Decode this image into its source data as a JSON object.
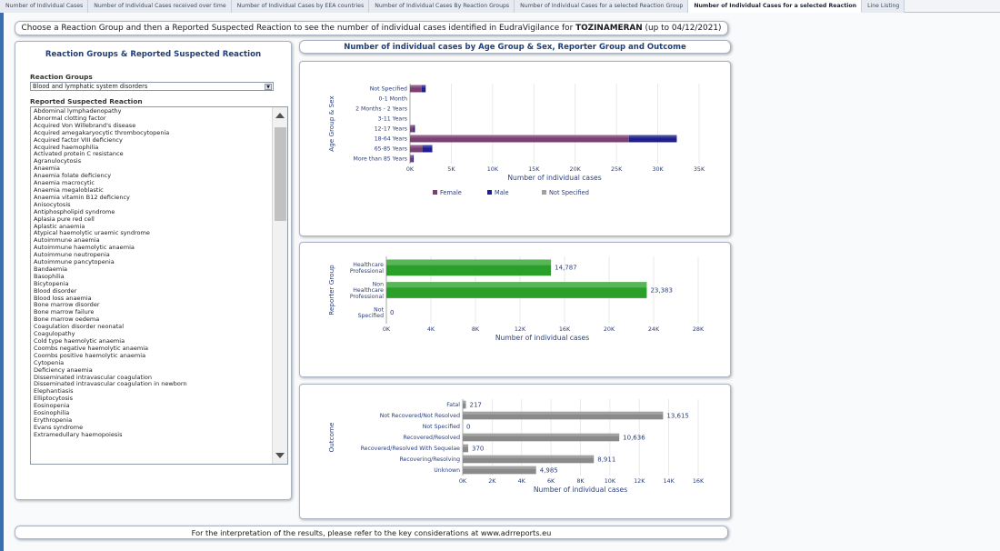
{
  "tabs": [
    {
      "label": "Number of Individual Cases",
      "active": false
    },
    {
      "label": "Number of Individual Cases received over time",
      "active": false
    },
    {
      "label": "Number of Individual Cases by EEA countries",
      "active": false
    },
    {
      "label": "Number of Individual Cases By Reaction Groups",
      "active": false
    },
    {
      "label": "Number of Individual Cases for a selected Reaction Group",
      "active": false
    },
    {
      "label": "Number of Individual Cases for a selected Reaction",
      "active": true
    },
    {
      "label": "Line Listing",
      "active": false
    }
  ],
  "header": {
    "text_before": "Choose a Reaction Group and then a Reported Suspected Reaction to see the number of individual cases identified in EudraVigilance for ",
    "product": "TOZINAMERAN",
    "text_after": " (up to 04/12/2021)"
  },
  "left_panel": {
    "title": "Reaction Groups & Reported Suspected Reaction",
    "reaction_groups_label": "Reaction Groups",
    "reaction_group_selected": "Blood and lymphatic system disorders",
    "reported_reaction_label": "Reported Suspected Reaction",
    "reactions": [
      "Abdominal lymphadenopathy",
      "Abnormal clotting factor",
      "Acquired Von Willebrand's disease",
      "Acquired amegakaryocytic thrombocytopenia",
      "Acquired factor VIII deficiency",
      "Acquired haemophilia",
      "Activated protein C resistance",
      "Agranulocytosis",
      "Anaemia",
      "Anaemia folate deficiency",
      "Anaemia macrocytic",
      "Anaemia megaloblastic",
      "Anaemia vitamin B12 deficiency",
      "Anisocytosis",
      "Antiphospholipid syndrome",
      "Aplasia pure red cell",
      "Aplastic anaemia",
      "Atypical haemolytic uraemic syndrome",
      "Autoimmune anaemia",
      "Autoimmune haemolytic anaemia",
      "Autoimmune neutropenia",
      "Autoimmune pancytopenia",
      "Bandaemia",
      "Basophilia",
      "Bicytopenia",
      "Blood disorder",
      "Blood loss anaemia",
      "Bone marrow disorder",
      "Bone marrow failure",
      "Bone marrow oedema",
      "Coagulation disorder neonatal",
      "Coagulopathy",
      "Cold type haemolytic anaemia",
      "Coombs negative haemolytic anaemia",
      "Coombs positive haemolytic anaemia",
      "Cytopenia",
      "Deficiency anaemia",
      "Disseminated intravascular coagulation",
      "Disseminated intravascular coagulation in newborn",
      "Elephantiasis",
      "Elliptocytosis",
      "Eosinopenia",
      "Eosinophilia",
      "Erythropenia",
      "Evans syndrome",
      "Extramedullary haemopoiesis"
    ]
  },
  "right_title": "Number of individual cases by Age Group & Sex, Reporter Group and Outcome",
  "footer": "For the interpretation of the results, please refer to the key considerations at www.adrreports.eu",
  "colors": {
    "female": "#7b3f73",
    "male": "#1f1f8f",
    "not_specified": "#a0a0a0",
    "reporter": "#2aa02a",
    "outcome": "#8a8a8a",
    "axis_text": "#2b3e78"
  },
  "chart_data": [
    {
      "type": "bar",
      "orientation": "horizontal",
      "stacked": true,
      "categories": [
        "Not Specified",
        "0-1 Month",
        "2 Months - 2 Years",
        "3-11 Years",
        "12-17 Years",
        "18-64 Years",
        "65-85 Years",
        "More than 85 Years"
      ],
      "series": [
        {
          "name": "Female",
          "values": [
            1400,
            0,
            0,
            0,
            400,
            26500,
            1500,
            300
          ]
        },
        {
          "name": "Male",
          "values": [
            500,
            0,
            0,
            0,
            200,
            5800,
            1200,
            150
          ]
        },
        {
          "name": "Not Specified",
          "values": [
            0,
            0,
            0,
            0,
            0,
            0,
            0,
            0
          ]
        }
      ],
      "xlabel": "Number of individual cases",
      "ylabel": "Age Group & Sex",
      "xlim": [
        0,
        35000
      ],
      "ticks": [
        "0K",
        "5K",
        "10K",
        "15K",
        "20K",
        "25K",
        "30K",
        "35K"
      ],
      "legend": "bottom",
      "grid": true
    },
    {
      "type": "bar",
      "orientation": "horizontal",
      "categories": [
        "Healthcare Professional",
        "Non Healthcare Professional",
        "Not Specified"
      ],
      "values": [
        14787,
        23383,
        0
      ],
      "labels": [
        "14,787",
        "23,383",
        "0"
      ],
      "xlabel": "Number of individual cases",
      "ylabel": "Reporter Group",
      "xlim": [
        0,
        28000
      ],
      "ticks": [
        "0K",
        "4K",
        "8K",
        "12K",
        "16K",
        "20K",
        "24K",
        "28K"
      ],
      "grid": true
    },
    {
      "type": "bar",
      "orientation": "horizontal",
      "categories": [
        "Fatal",
        "Not Recovered/Not Resolved",
        "Not Specified",
        "Recovered/Resolved",
        "Recovered/Resolved With Sequelae",
        "Recovering/Resolving",
        "Unknown"
      ],
      "values": [
        217,
        13615,
        0,
        10636,
        370,
        8911,
        4985
      ],
      "labels": [
        "217",
        "13,615",
        "0",
        "10,636",
        "370",
        "8,911",
        "4,985"
      ],
      "xlabel": "Number of individual cases",
      "ylabel": "Outcome",
      "xlim": [
        0,
        16000
      ],
      "ticks": [
        "0K",
        "2K",
        "4K",
        "6K",
        "8K",
        "10K",
        "12K",
        "14K",
        "16K"
      ],
      "grid": true
    }
  ]
}
